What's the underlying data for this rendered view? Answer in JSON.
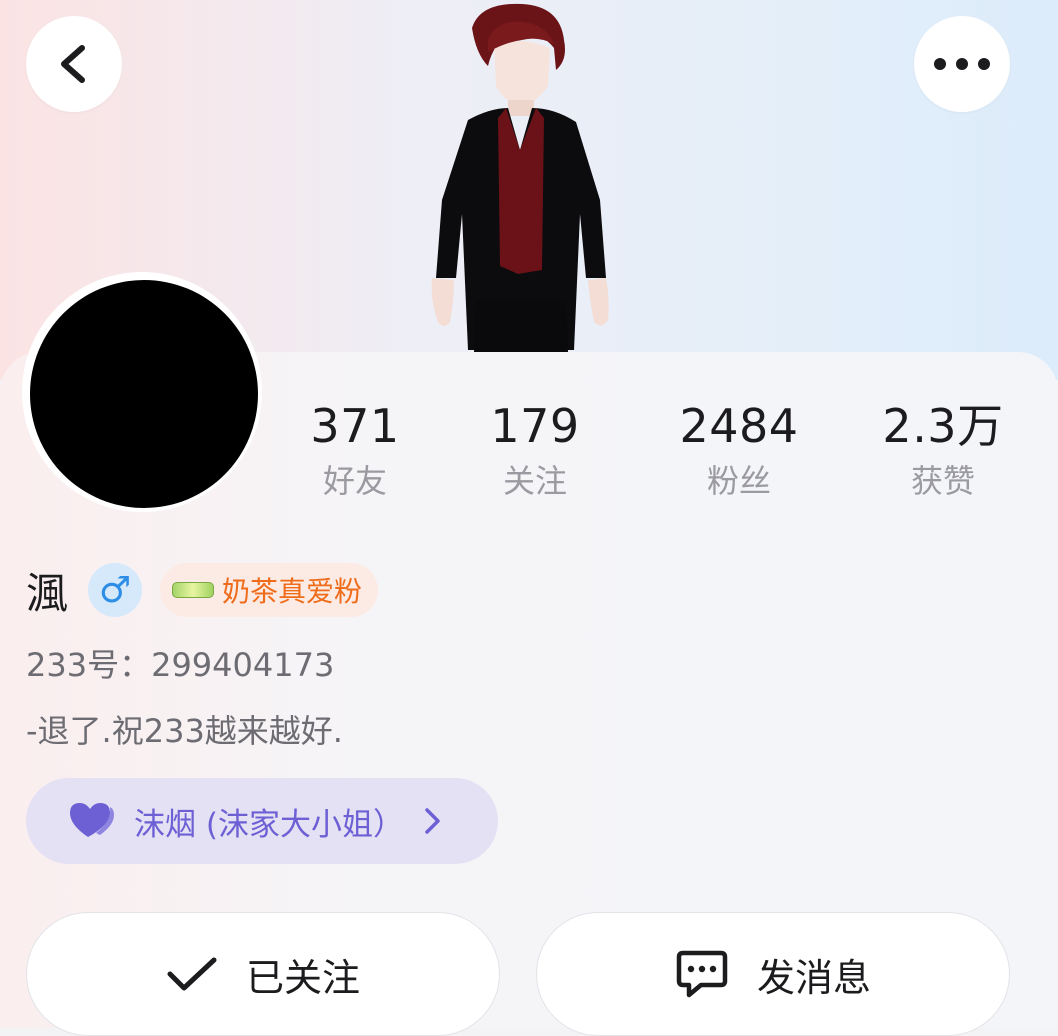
{
  "header": {
    "back_icon": "chevron-left-icon",
    "more_icon": "more-horizontal-icon"
  },
  "stats": [
    {
      "value": "371",
      "label": "好友"
    },
    {
      "value": "179",
      "label": "关注"
    },
    {
      "value": "2484",
      "label": "粉丝"
    },
    {
      "value": "2.3万",
      "label": "获赞"
    }
  ],
  "profile": {
    "nickname": "渢",
    "gender_symbol": "♂",
    "gender_color": "#2e8ee6",
    "fan_badge": "奶茶真爱粉",
    "fan_badge_color": "#ef6c1a",
    "uid": "233号：299404173",
    "bio": "-退了.祝233越来越好."
  },
  "relation": {
    "text": "沫烟 (沫家大小姐）",
    "color": "#6d5fd4"
  },
  "actions": {
    "follow_label": "已关注",
    "message_label": "发消息"
  }
}
